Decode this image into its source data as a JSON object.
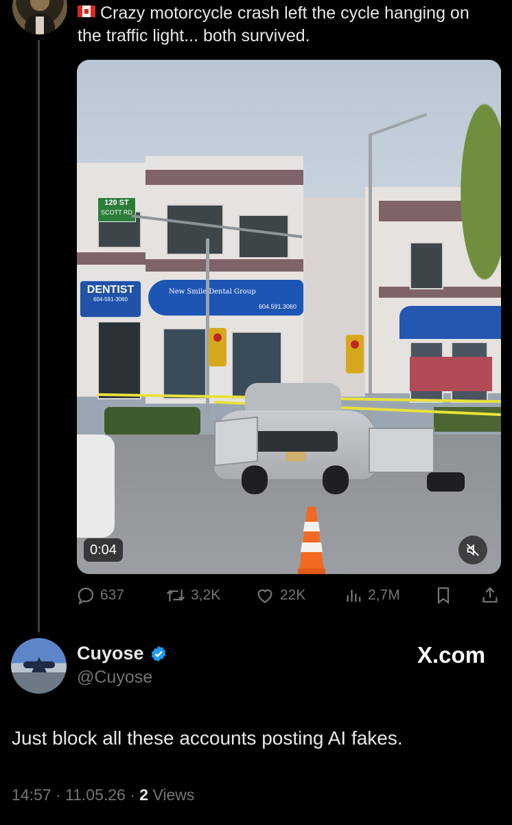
{
  "tweet": {
    "flag_icon": "canada-flag-icon",
    "text": "Crazy motorcycle crash left the cycle hanging on the traffic light... both survived."
  },
  "video": {
    "timestamp": "0:04",
    "mute_icon": "speaker-muted-icon",
    "scene": {
      "street_sign": {
        "line1": "120 ST",
        "line2": "SCOTT RD"
      },
      "dentist_sign": {
        "title": "DENTIST",
        "phone": "604-591-3060"
      },
      "dental_awning": {
        "name": "New Smile Dental Group",
        "phone": "604.591.3060"
      }
    }
  },
  "actions": {
    "replies": "637",
    "reposts": "3,2K",
    "likes": "22K",
    "views": "2,7M"
  },
  "reply": {
    "name": "Cuyose",
    "handle": "@Cuyose",
    "brand": "X.com",
    "text": "Just block all these accounts posting AI fakes.",
    "time": "14:57",
    "date": "11.05.26",
    "views_count": "2",
    "views_label": "Views",
    "separator": "·"
  },
  "colors": {
    "background": "#000000",
    "text": "#e7e9ea",
    "muted": "#71767b",
    "verified": "#1d9bf0"
  }
}
